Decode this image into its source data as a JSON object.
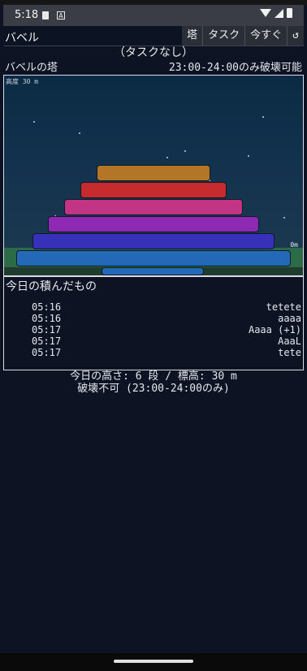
{
  "status": {
    "time": "5:18",
    "notif_letter": "A"
  },
  "header": {
    "title": "バベル",
    "nav": [
      "塔",
      "タスク",
      "今すぐ",
      "↺"
    ]
  },
  "task_status": "（タスクなし）",
  "tower": {
    "title": "バベルの塔",
    "break_window": "23:00-24:00のみ破壊可能",
    "altitude": "高度 30 m",
    "ground_label": "0m",
    "blocks": [
      {
        "color": "#b27626",
        "level": 6
      },
      {
        "color": "#c62b2f",
        "level": 5
      },
      {
        "color": "#c23585",
        "level": 4
      },
      {
        "color": "#8d29b3",
        "level": 3
      },
      {
        "color": "#3631b8",
        "level": 2
      },
      {
        "color": "#2468b8",
        "level": 1
      },
      {
        "color": "#2468b8",
        "level": 0
      }
    ]
  },
  "today": {
    "title": "今日の積んだもの",
    "items": [
      {
        "time": "05:16",
        "text": "tetete"
      },
      {
        "time": "05:16",
        "text": "aaaa"
      },
      {
        "time": "05:17",
        "text": "Aaaa (+1)"
      },
      {
        "time": "05:17",
        "text": "AaaL"
      },
      {
        "time": "05:17",
        "text": "tete"
      }
    ]
  },
  "summary": {
    "height_text": "今日の高さ: 6 段 / 標高: 30 m",
    "destroy_text": "破壊不可 (23:00-24:00のみ)"
  }
}
